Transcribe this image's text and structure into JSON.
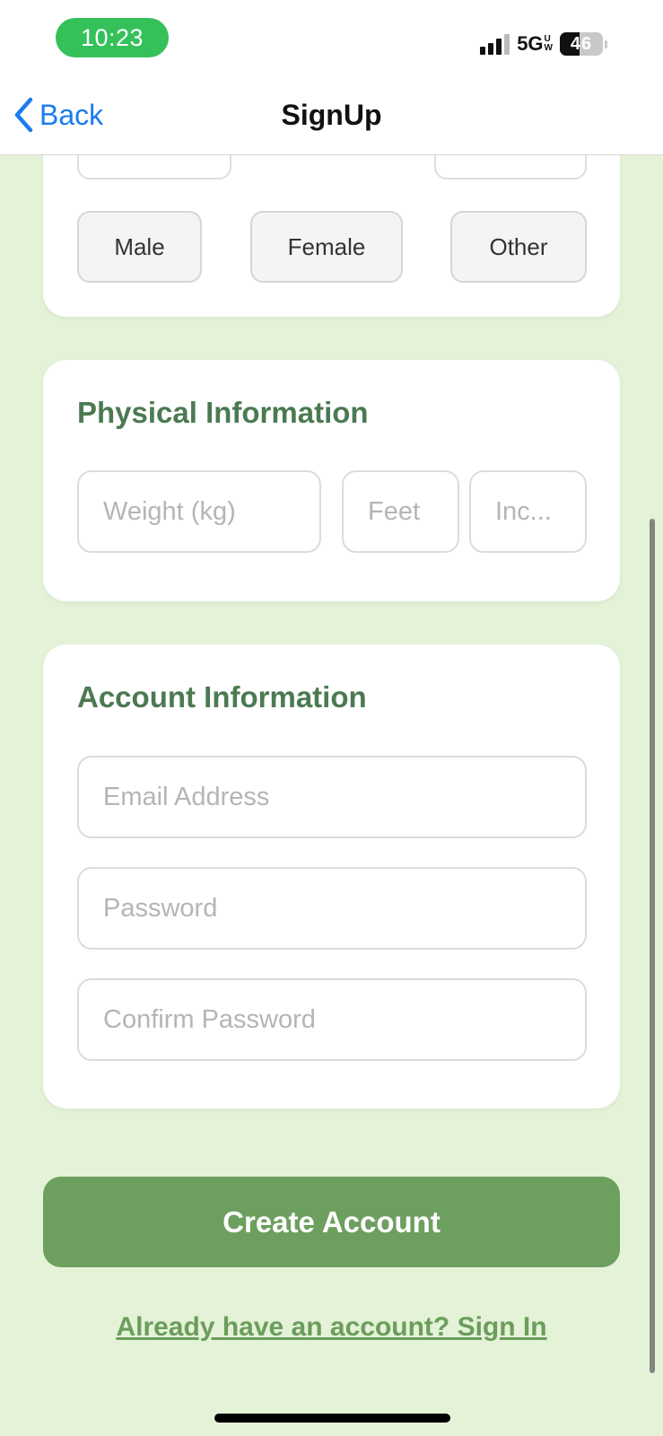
{
  "status_bar": {
    "time": "10:23",
    "network": "5G",
    "network_sub": [
      "U",
      "W"
    ],
    "battery_level": "46",
    "battery_fraction": 0.46,
    "signal_icon": "cellular-signal-icon",
    "battery_icon": "battery-icon"
  },
  "nav": {
    "back_label": "Back",
    "back_icon": "chevron-left-icon",
    "title": "SignUp"
  },
  "gender": {
    "options": [
      "Male",
      "Female",
      "Other"
    ]
  },
  "physical": {
    "title": "Physical Information",
    "weight_placeholder": "Weight (kg)",
    "feet_placeholder": "Feet",
    "inches_placeholder": "Inc..."
  },
  "account": {
    "title": "Account Information",
    "email_placeholder": "Email Address",
    "password_placeholder": "Password",
    "confirm_placeholder": "Confirm Password"
  },
  "actions": {
    "create_label": "Create Account",
    "signin_label": "Already have an account? Sign In"
  },
  "colors": {
    "background": "#e4f2d8",
    "accent_green": "#6d9f5f",
    "section_title": "#4b7a52",
    "ios_blue": "#1a7cf0",
    "time_pill": "#34c15a"
  }
}
